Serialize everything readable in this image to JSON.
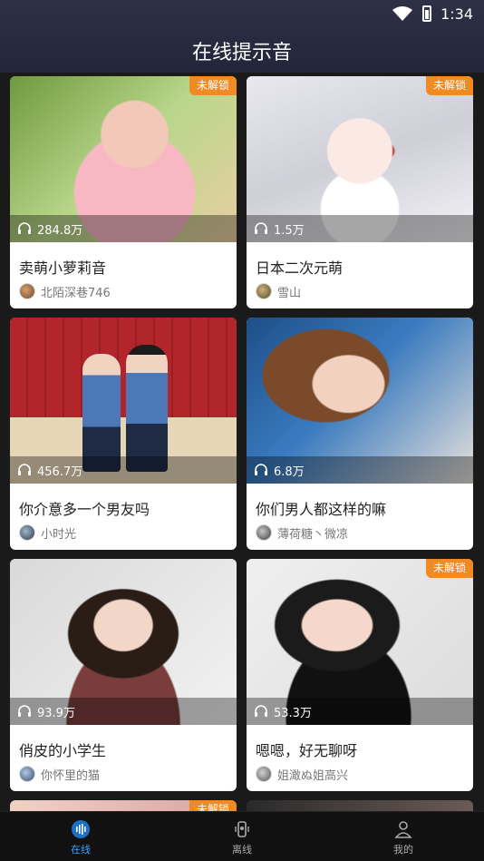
{
  "status_bar": {
    "time": "1:34"
  },
  "header": {
    "title": "在线提示音"
  },
  "colors": {
    "accent": "#3aa0ff",
    "lock_badge": "#f08a22"
  },
  "cards": [
    {
      "title": "卖萌小萝莉音",
      "plays": "284.8万",
      "author": "北陌深巷746",
      "locked": true,
      "lock_label": "未解锁"
    },
    {
      "title": "日本二次元萌",
      "plays": "1.5万",
      "author": "雪山",
      "locked": true,
      "lock_label": "未解锁"
    },
    {
      "title": "你介意多一个男友吗",
      "plays": "456.7万",
      "author": "小时光",
      "locked": false
    },
    {
      "title": "你们男人都这样的嘛",
      "plays": "6.8万",
      "author": "薄荷糖丶微凉",
      "locked": false
    },
    {
      "title": "俏皮的小学生",
      "plays": "93.9万",
      "author": "你怀里的猫",
      "locked": false
    },
    {
      "title": "嗯嗯，好无聊呀",
      "plays": "53.3万",
      "author": "姐澉ぬ姐高兴",
      "locked": true,
      "lock_label": "未解锁"
    }
  ],
  "peek_cards": [
    {
      "locked": true,
      "lock_label": "未解锁"
    },
    {
      "locked": false
    }
  ],
  "bottom_nav": {
    "items": [
      {
        "label": "在线",
        "icon": "waveform-icon",
        "active": true
      },
      {
        "label": "离线",
        "icon": "phone-vibrate-icon",
        "active": false
      },
      {
        "label": "我的",
        "icon": "person-icon",
        "active": false
      }
    ]
  }
}
